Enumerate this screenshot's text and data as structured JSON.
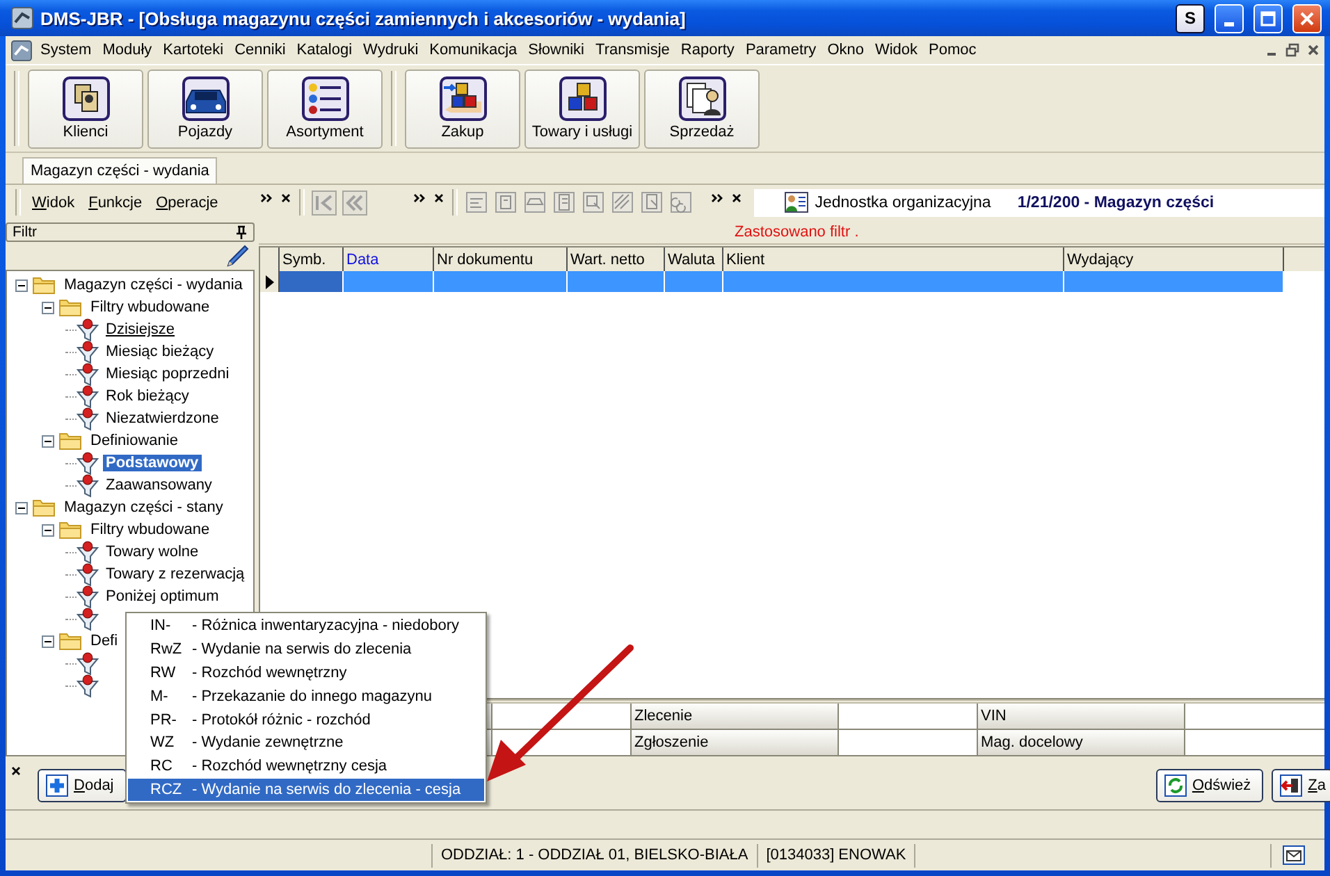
{
  "window": {
    "title": "DMS-JBR - [Obsługa magazynu części zamiennych i akcesoriów - wydania]",
    "extra_button": "S"
  },
  "menu": [
    "System",
    "Moduły",
    "Kartoteki",
    "Cenniki",
    "Katalogi",
    "Wydruki",
    "Komunikacja",
    "Słowniki",
    "Transmisje",
    "Raporty",
    "Parametry",
    "Okno",
    "Widok",
    "Pomoc"
  ],
  "toolbar": {
    "groups": [
      [
        "Klienci",
        "Pojazdy",
        "Asortyment"
      ],
      [
        "Zakup",
        "Towary i usługi",
        "Sprzedaż"
      ]
    ]
  },
  "tabs": [
    {
      "label": "Magazyn części - wydania",
      "selected": true
    }
  ],
  "subtoolbar": {
    "menus": [
      "Widok",
      "Funkcje",
      "Operacje"
    ],
    "org_unit": {
      "label": "Jednostka organizacyjna",
      "value": "1/21/200 - Magazyn części"
    }
  },
  "filter_panel": {
    "title": "Filtr",
    "tree": [
      {
        "kind": "folder",
        "label": "Magazyn części - wydania",
        "expanded": true,
        "children": [
          {
            "kind": "folder",
            "label": "Filtry wbudowane",
            "expanded": true,
            "children": [
              {
                "kind": "filter",
                "label": "Dzisiejsze",
                "selected": false,
                "hovered": true
              },
              {
                "kind": "filter",
                "label": "Miesiąc bieżący",
                "selected": false,
                "hovered": false
              },
              {
                "kind": "filter",
                "label": "Miesiąc poprzedni",
                "selected": false,
                "hovered": false
              },
              {
                "kind": "filter",
                "label": "Rok bieżący",
                "selected": false,
                "hovered": false
              },
              {
                "kind": "filter",
                "label": "Niezatwierdzone",
                "selected": false,
                "hovered": false
              }
            ]
          },
          {
            "kind": "folder",
            "label": "Definiowanie",
            "expanded": true,
            "children": [
              {
                "kind": "filter",
                "label": "Podstawowy",
                "selected": true,
                "hovered": false
              },
              {
                "kind": "filter",
                "label": "Zaawansowany",
                "selected": false,
                "hovered": false
              }
            ]
          }
        ]
      },
      {
        "kind": "folder",
        "label": "Magazyn części - stany",
        "expanded": true,
        "children": [
          {
            "kind": "folder",
            "label": "Filtry wbudowane",
            "expanded": true,
            "children": [
              {
                "kind": "filter",
                "label": "Towary wolne",
                "selected": false,
                "hovered": false
              },
              {
                "kind": "filter",
                "label": "Towary z rezerwacją",
                "selected": false,
                "hovered": false
              },
              {
                "kind": "filter",
                "label": "Poniżej optimum",
                "selected": false,
                "hovered": false
              },
              {
                "kind": "filter"
              }
            ]
          },
          {
            "kind": "folder",
            "label": "Defi",
            "expanded": true,
            "children": [
              {
                "kind": "filter"
              },
              {
                "kind": "filter"
              }
            ]
          }
        ]
      }
    ]
  },
  "filter_notice": "Zastosowano filtr .",
  "table": {
    "columns": [
      {
        "label": "Symb.",
        "sorted": false
      },
      {
        "label": "Data",
        "sorted": true
      },
      {
        "label": "Nr dokumentu",
        "sorted": false
      },
      {
        "label": "Wart. netto",
        "sorted": false
      },
      {
        "label": "Waluta",
        "sorted": false
      },
      {
        "label": "Klient",
        "sorted": false
      },
      {
        "label": "Wydający",
        "sorted": false
      }
    ],
    "rows": [
      {
        "selected": true
      }
    ]
  },
  "details": [
    {
      "label": "Zlecenie"
    },
    {
      "label": "VIN"
    },
    {
      "label": "Zgłoszenie"
    },
    {
      "label": "Mag. docelowy"
    }
  ],
  "buttons": {
    "add": "Dodaj",
    "refresh": "Odśwież",
    "close": "Za"
  },
  "popup_menu": [
    {
      "code": "IN-",
      "label": "- Różnica inwentaryzacyjna - niedobory",
      "selected": false
    },
    {
      "code": "RwZ",
      "label": "- Wydanie na serwis do zlecenia",
      "selected": false
    },
    {
      "code": "RW",
      "label": "- Rozchód wewnętrzny",
      "selected": false
    },
    {
      "code": "M-",
      "label": "- Przekazanie do innego magazynu",
      "selected": false
    },
    {
      "code": "PR-",
      "label": "- Protokół różnic - rozchód",
      "selected": false
    },
    {
      "code": "WZ",
      "label": "- Wydanie zewnętrzne",
      "selected": false
    },
    {
      "code": "RC",
      "label": "- Rozchód wewnętrzny cesja",
      "selected": false
    },
    {
      "code": "RCZ",
      "label": "- Wydanie na serwis do zlecenia - cesja",
      "selected": true
    }
  ],
  "status_bar": [
    "ODDZIAŁ: 1 - ODDZIAŁ 01, BIELSKO-BIAŁA",
    "[0134033] ENOWAK"
  ]
}
